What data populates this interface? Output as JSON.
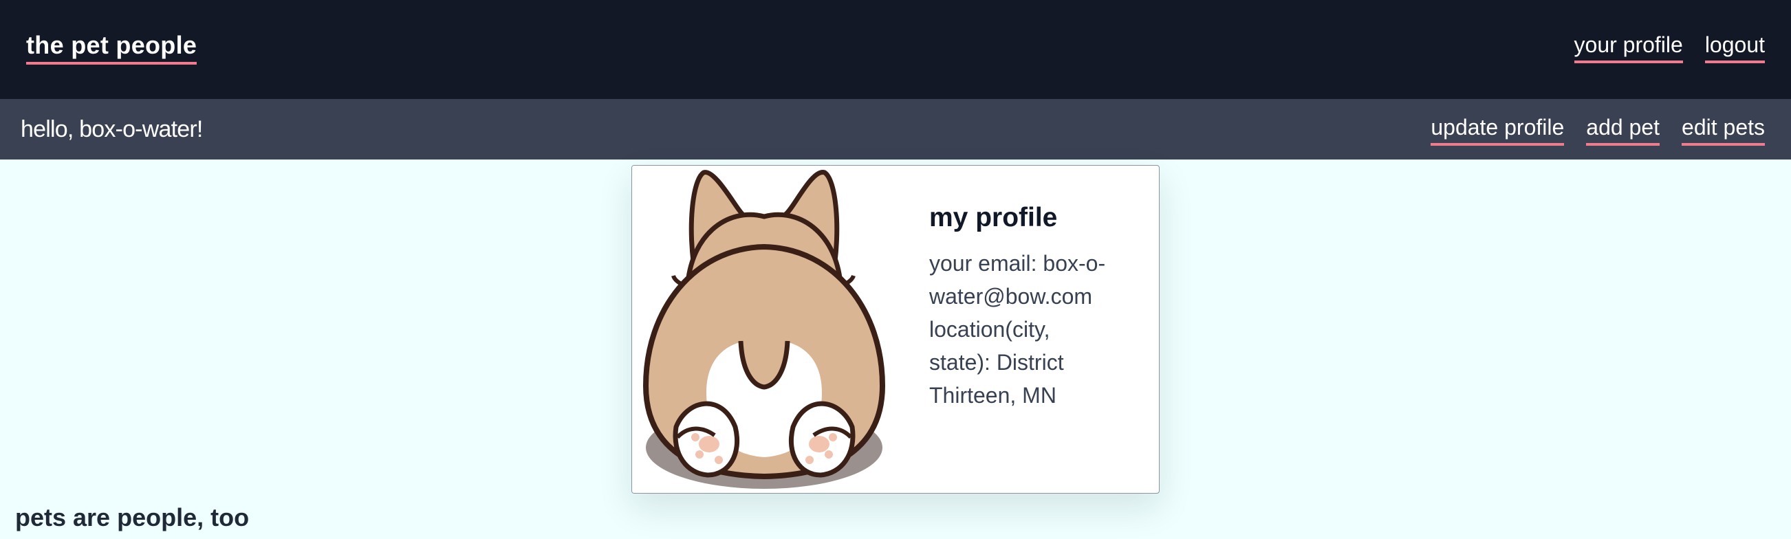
{
  "header": {
    "brand": "the pet people",
    "nav": [
      {
        "label": "your profile"
      },
      {
        "label": "logout"
      }
    ]
  },
  "subheader": {
    "greeting": "hello, box-o-water!",
    "actions": [
      {
        "label": "update profile"
      },
      {
        "label": "add pet"
      },
      {
        "label": "edit pets"
      }
    ]
  },
  "profile_card": {
    "image_icon": "corgi-butt-illustration",
    "title": "my profile",
    "lines": [
      "your email: box-o-",
      "water@bow.com",
      "location(city,",
      "state): District",
      "Thirteen, MN"
    ]
  },
  "footer": {
    "heading": "pets are people, too"
  },
  "colors": {
    "topbar": "#121826",
    "subbar": "#3a4152",
    "page_bg": "#effefe",
    "link_underline": "#f07b8e"
  }
}
